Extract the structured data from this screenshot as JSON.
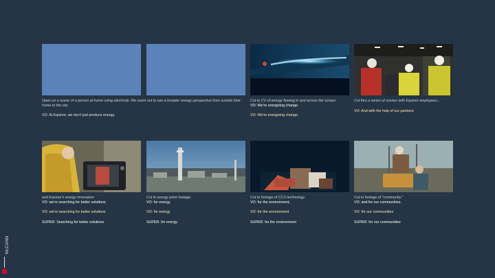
{
  "frames": [
    {
      "desc": "Open on a scene of a person at home using electricity. We zoom out to see a broader energy perspective from outside their home to the city.",
      "vo": "VO: At Equinor, we don't just produce energy."
    },
    {
      "desc": "Cut to CU of energy flowing in and across the screen.",
      "vo_inline": "VO: We're energizing change.",
      "vo": "VO: We're energizing change."
    },
    {
      "desc": "Cut thru a series of scenes with Equinor employees...",
      "vo": "VO: And with the help of our partners"
    },
    {
      "desc": "and Equinor's energy innovation.",
      "vo_inline": "VO: we're searching for better solutions",
      "vo": "VO: we're searching for better solutions",
      "super": "SUPER:  Searching for better solutions"
    },
    {
      "desc": "Cut to energy plant footage.",
      "vo_inline": "VO: for energy,",
      "vo": "VO: for energy",
      "super": "SUPER:  for energy"
    },
    {
      "desc": "Cut to footage of CCS technology.",
      "vo_inline": "VO: for the environment,",
      "vo": "VO: for the environment",
      "super": "SUPER:  for the environment"
    },
    {
      "desc": "Cut to footage of \"community.\"",
      "vo_inline": "VO: and for our communities.",
      "vo": "VO: for our communities",
      "super": "SUPER:  for our communities"
    }
  ],
  "brand": "McCANN",
  "colors": {
    "background": "#253545",
    "placeholder": "#5b83b9",
    "vo_highlight": "#ffe9a8",
    "logo_red": "#c8102e"
  }
}
